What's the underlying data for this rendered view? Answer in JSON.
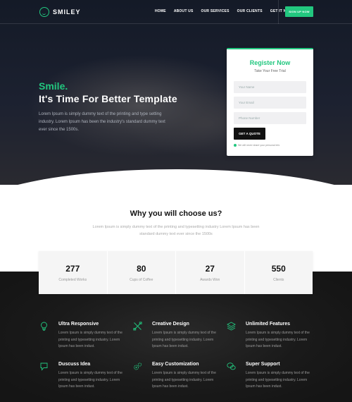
{
  "brand": {
    "name": "SMILEY",
    "accent": "#22c77f"
  },
  "nav": {
    "items": [
      "HOME",
      "ABOUT US",
      "OUR SERVICES",
      "OUR CLIENTS",
      "GET IT NOW"
    ],
    "signup_label": "SIGN UP NOW"
  },
  "hero": {
    "smile": "Smile.",
    "title": "It's Time For Better Template",
    "description": "Lorem Ipsum is simply dummy text of the printing and type setting industry. Lorem Ipsum has been the industry's standard dummy text ever since the 1500s."
  },
  "register": {
    "title": "Register Now",
    "subtitle": "Take Your Free Trial",
    "name_placeholder": "Your Name",
    "email_placeholder": "Your Email",
    "phone_placeholder": "Phone Number",
    "button_label": "GET A QUOTE",
    "note": "We will never share your personal info"
  },
  "why": {
    "title": "Why you will choose us?",
    "description": "Lorem Ipsum is simply dummy text of the printing and typesetting industry Lorem Ipsum has been standard dummy text ever since the 1500s"
  },
  "stats": [
    {
      "number": "277",
      "label": "Completed Works"
    },
    {
      "number": "80",
      "label": "Cups of Coffee"
    },
    {
      "number": "27",
      "label": "Awards Won"
    },
    {
      "number": "550",
      "label": "Clients"
    }
  ],
  "features": [
    {
      "icon": "lightbulb-icon",
      "title": "Ultra Responsive",
      "description": "Lorem Ipsum is simply dummy text of the printing and typesetting industry. Lorem Ipsum has been indust."
    },
    {
      "icon": "design-tools-icon",
      "title": "Creative Design",
      "description": "Lorem Ipsum is simply dummy text of the printing and typesetting industry. Lorem Ipsum has been indust."
    },
    {
      "icon": "layers-icon",
      "title": "Unlimited Features",
      "description": "Lorem Ipsum is simply dummy text of the printing and typesetting industry. Lorem Ipsum has been indust."
    },
    {
      "icon": "chat-bubble-icon",
      "title": "Duscuss Idea",
      "description": "Lorem Ipsum is simply dummy text of the printing and typesetting industry. Lorem Ipsum has been indust."
    },
    {
      "icon": "gears-icon",
      "title": "Easy Customization",
      "description": "Lorem Ipsum is simply dummy text of the printing and typesetting industry. Lorem Ipsum has been indust."
    },
    {
      "icon": "speech-bubbles-icon",
      "title": "Super Support",
      "description": "Lorem Ipsum is simply dummy text of the printing and typesetting industry. Lorem Ipsum has been indust."
    }
  ]
}
